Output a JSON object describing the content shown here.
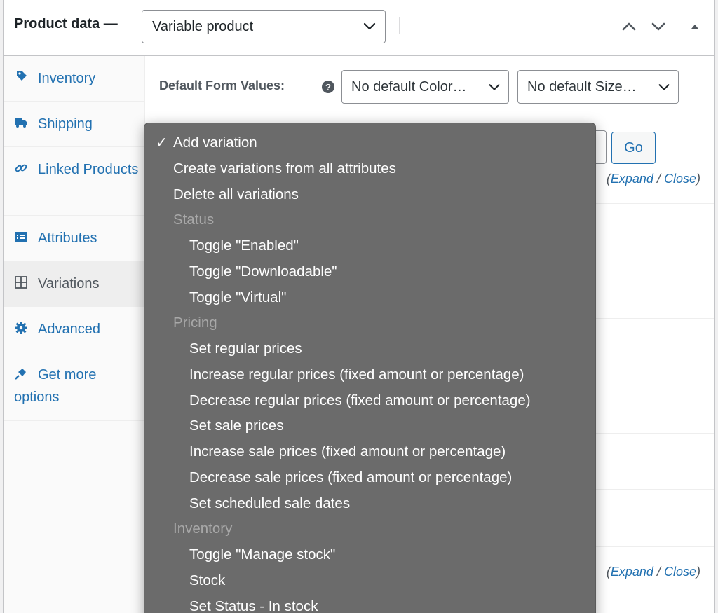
{
  "header": {
    "title": "Product data —",
    "product_type": "Variable product"
  },
  "sidebar": {
    "items": [
      {
        "label": "Inventory",
        "icon": "inventory-icon"
      },
      {
        "label": "Shipping",
        "icon": "truck-icon"
      },
      {
        "label": "Linked Products",
        "icon": "link-icon"
      },
      {
        "label": "Attributes",
        "icon": "list-icon"
      },
      {
        "label": "Variations",
        "icon": "grid-icon"
      },
      {
        "label": "Advanced",
        "icon": "gear-icon"
      },
      {
        "label": "Get more options",
        "icon": "plugin-icon"
      }
    ],
    "active": "Variations"
  },
  "main": {
    "default_form_label": "Default Form Values:",
    "color_select": "No default Color…",
    "size_select": "No default Size…",
    "go_label": "Go",
    "expand_label": "Expand",
    "close_label": "Close",
    "sep": " / ",
    "paren_close": ")",
    "paren_open": "("
  },
  "dropdown": {
    "selected": "Add variation",
    "check": "✓",
    "options": [
      {
        "label": "Add variation",
        "kind": "option",
        "level": 0
      },
      {
        "label": "Create variations from all attributes",
        "kind": "option",
        "level": 0
      },
      {
        "label": "Delete all variations",
        "kind": "option",
        "level": 0
      },
      {
        "label": "Status",
        "kind": "group",
        "level": 0
      },
      {
        "label": "Toggle \"Enabled\"",
        "kind": "option",
        "level": 1
      },
      {
        "label": "Toggle \"Downloadable\"",
        "kind": "option",
        "level": 1
      },
      {
        "label": "Toggle \"Virtual\"",
        "kind": "option",
        "level": 1
      },
      {
        "label": "Pricing",
        "kind": "group",
        "level": 0
      },
      {
        "label": "Set regular prices",
        "kind": "option",
        "level": 1
      },
      {
        "label": "Increase regular prices (fixed amount or percentage)",
        "kind": "option",
        "level": 1
      },
      {
        "label": "Decrease regular prices (fixed amount or percentage)",
        "kind": "option",
        "level": 1
      },
      {
        "label": "Set sale prices",
        "kind": "option",
        "level": 1
      },
      {
        "label": "Increase sale prices (fixed amount or percentage)",
        "kind": "option",
        "level": 1
      },
      {
        "label": "Decrease sale prices (fixed amount or percentage)",
        "kind": "option",
        "level": 1
      },
      {
        "label": "Set scheduled sale dates",
        "kind": "option",
        "level": 1
      },
      {
        "label": "Inventory",
        "kind": "group",
        "level": 0
      },
      {
        "label": "Toggle \"Manage stock\"",
        "kind": "option",
        "level": 1
      },
      {
        "label": "Stock",
        "kind": "option",
        "level": 1
      },
      {
        "label": "Set Status - In stock",
        "kind": "option",
        "level": 1
      }
    ]
  },
  "colors": {
    "link": "#2271b1",
    "dropdown_bg": "#6b6b6b",
    "group_text": "#a8a8a8"
  }
}
